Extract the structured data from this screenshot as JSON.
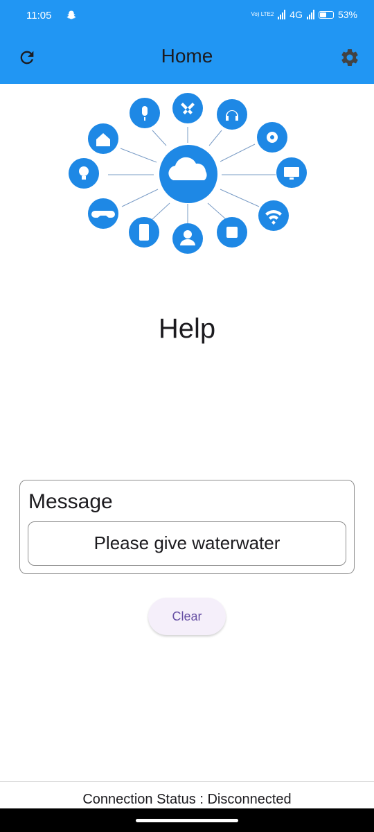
{
  "status_bar": {
    "time": "11:05",
    "network_label": "4G",
    "volte_label": "Vo) LTE2",
    "battery_percent": "53%",
    "battery_level": 0.53,
    "icons": [
      "snapchat-icon",
      "signal-icon",
      "battery-icon"
    ]
  },
  "app_bar": {
    "title": "Home",
    "background_color": "#2196f3",
    "left_icon": "refresh-icon",
    "right_icon": "settings-gear-icon"
  },
  "hero": {
    "center_icon": "cloud-icon",
    "satellite_icons": [
      "microphone-icon",
      "tools-icon",
      "headphones-icon",
      "gear-icon",
      "monitor-icon",
      "wifi-icon",
      "chip-icon",
      "user-icon",
      "phone-icon",
      "gamepad-icon",
      "lightbulb-icon",
      "home-icon"
    ],
    "circle_color": "#1e88e5"
  },
  "page": {
    "heading": "Help"
  },
  "message_card": {
    "label": "Message",
    "value": "Please give waterwater"
  },
  "actions": {
    "clear_label": "Clear",
    "accent_color": "#6750a4"
  },
  "footer": {
    "connection_status": "Connection Status : Disconnected"
  }
}
